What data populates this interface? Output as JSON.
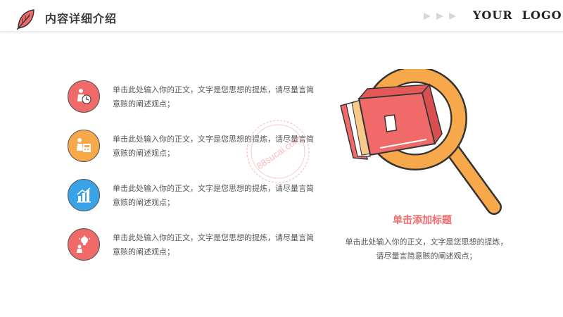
{
  "header": {
    "title": "内容详细介绍",
    "logo": "YOUR  LOGO"
  },
  "items": [
    {
      "text": "单击此处输入你的正文，文字是您思想的提炼，请尽量言简意赅的阐述观点；",
      "color": "#f06a6a",
      "icon": "businessman-clock-icon"
    },
    {
      "text": "单击此处输入你的正文，文字是您思想的提炼，请尽量言简意赅的阐述观点；",
      "color": "#f7a84a",
      "icon": "calculator-icon"
    },
    {
      "text": "单击此处输入你的正文，文字是您思想的提炼，请尽量言简意赅的阐述观点；",
      "color": "#3aa3e8",
      "icon": "bar-chart-icon"
    },
    {
      "text": "单击此处输入你的正文，文字是您思想的提炼，请尽量言简意赅的阐述观点；",
      "color": "#f06a6a",
      "icon": "lightbulb-person-icon"
    }
  ],
  "feature": {
    "title": "单击添加标题",
    "body": "单击此处输入你的正文，文字是您思想的提炼，请尽量言简意赅的阐述观点；"
  },
  "watermark": "88sucai.com",
  "colors": {
    "accent_red": "#f06a6a",
    "accent_orange": "#f7a84a",
    "accent_blue": "#3aa3e8"
  }
}
